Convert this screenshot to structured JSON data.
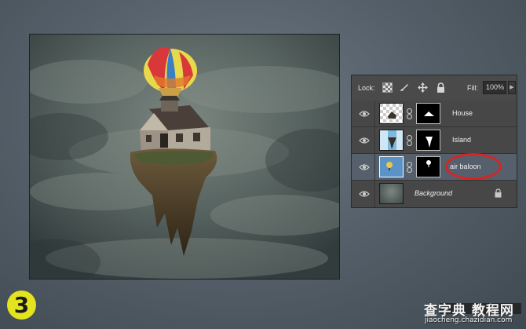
{
  "layers_panel": {
    "lock_label": "Lock:",
    "lock_icons": [
      "lock-transparent-pixels-icon",
      "lock-image-pixels-icon",
      "lock-position-icon",
      "lock-all-icon"
    ],
    "fill_label": "Fill:",
    "fill_value": "100%",
    "layers": [
      {
        "name": "House",
        "visible": true,
        "selected": false,
        "has_mask": true
      },
      {
        "name": "Island",
        "visible": true,
        "selected": false,
        "has_mask": true
      },
      {
        "name": "air baloon",
        "visible": true,
        "selected": true,
        "has_mask": true
      },
      {
        "name": "Background",
        "visible": true,
        "selected": false,
        "has_mask": false,
        "locked": true
      }
    ]
  },
  "step": {
    "number": "3"
  },
  "watermark": {
    "main": "查字典 教程网",
    "sub": "jiaocheng.chazidian.com"
  },
  "colors": {
    "highlight_oval": "#d42626",
    "badge": "#e3e31f",
    "selected_layer": "#56606c"
  }
}
